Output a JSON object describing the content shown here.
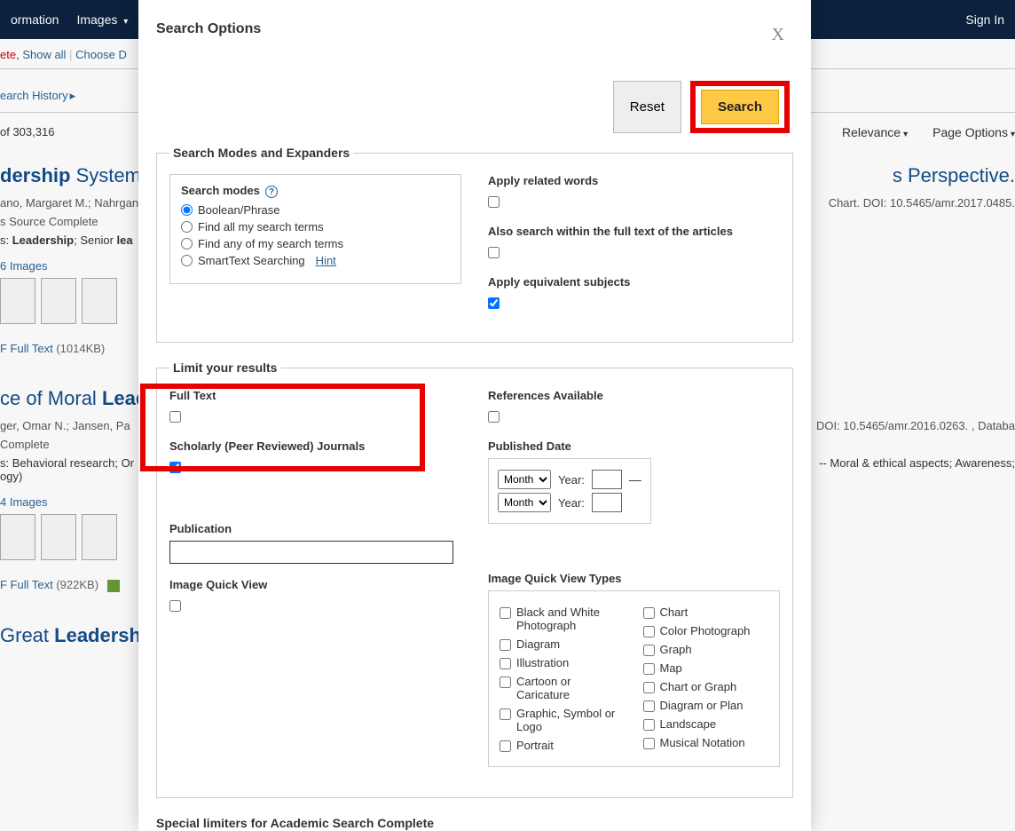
{
  "nav": {
    "info": "ormation",
    "images": "Images",
    "signin": "Sign In"
  },
  "subrow": {
    "ete": "ete,",
    "showall": "Show all",
    "choose": "Choose D"
  },
  "hist": {
    "label": "earch History",
    "caret": "▸"
  },
  "results": {
    "count": "of 303,316",
    "relevance": "Relevance",
    "pageopts": "Page Options"
  },
  "r1": {
    "title_prefix": "dership",
    "title_rest": " Systems",
    "title_tail": "s Perspective.",
    "authors": "ano, Margaret M.; Nahrgan",
    "source": "s Source Complete",
    "doi": "Chart. DOI: 10.5465/amr.2017.0485.",
    "subj_prefix": "s: ",
    "subj_bold1": "Leadership",
    "subj_mid": "; Senior ",
    "subj_bold2": "lea",
    "images": "6 Images",
    "pdf": "F Full Text",
    "size": "(1014KB)"
  },
  "r2": {
    "title_prefix": "ce of Moral ",
    "title_bold": "Lead",
    "authors": "ger, Omar N.; Jansen, Pa",
    "source": "Complete",
    "doi": "DOI: 10.5465/amr.2016.0263. , Databa",
    "subj_prefix": "s: ",
    "subj1": "Behavioral research; Or",
    "subj2": "ogy)",
    "subj_tail": "-- Moral & ethical aspects; Awareness;",
    "images": "4 Images",
    "pdf": "F Full Text",
    "size": "(922KB)"
  },
  "r3": {
    "title_prefix": "Great ",
    "title_bold": "Leadership"
  },
  "modal": {
    "title": "Search Options",
    "close": "X",
    "reset": "Reset",
    "search": "Search",
    "legend1": "Search Modes and Expanders",
    "legend2": "Limit your results",
    "legend3": "Special limiters for Academic Search Complete",
    "modes_label": "Search modes",
    "mode1": "Boolean/Phrase",
    "mode2": "Find all my search terms",
    "mode3": "Find any of my search terms",
    "mode4": "SmartText Searching",
    "hint": "Hint",
    "related": "Apply related words",
    "fulltextwithin": "Also search within the full text of the articles",
    "equiv": "Apply equivalent subjects",
    "fulltext": "Full Text",
    "refs": "References Available",
    "scholarly": "Scholarly (Peer Reviewed) Journals",
    "pubdate": "Published Date",
    "month": "Month",
    "year": "Year:",
    "publication": "Publication",
    "iqv": "Image Quick View",
    "iqvt": "Image Quick View Types",
    "t_bw": "Black and White Photograph",
    "t_diagram": "Diagram",
    "t_ill": "Illustration",
    "t_cartoon": "Cartoon or Caricature",
    "t_gsl": "Graphic, Symbol or Logo",
    "t_portrait": "Portrait",
    "t_chart": "Chart",
    "t_cphoto": "Color Photograph",
    "t_graph": "Graph",
    "t_map": "Map",
    "t_cg": "Chart or Graph",
    "t_dp": "Diagram or Plan",
    "t_land": "Landscape",
    "t_music": "Musical Notation"
  }
}
